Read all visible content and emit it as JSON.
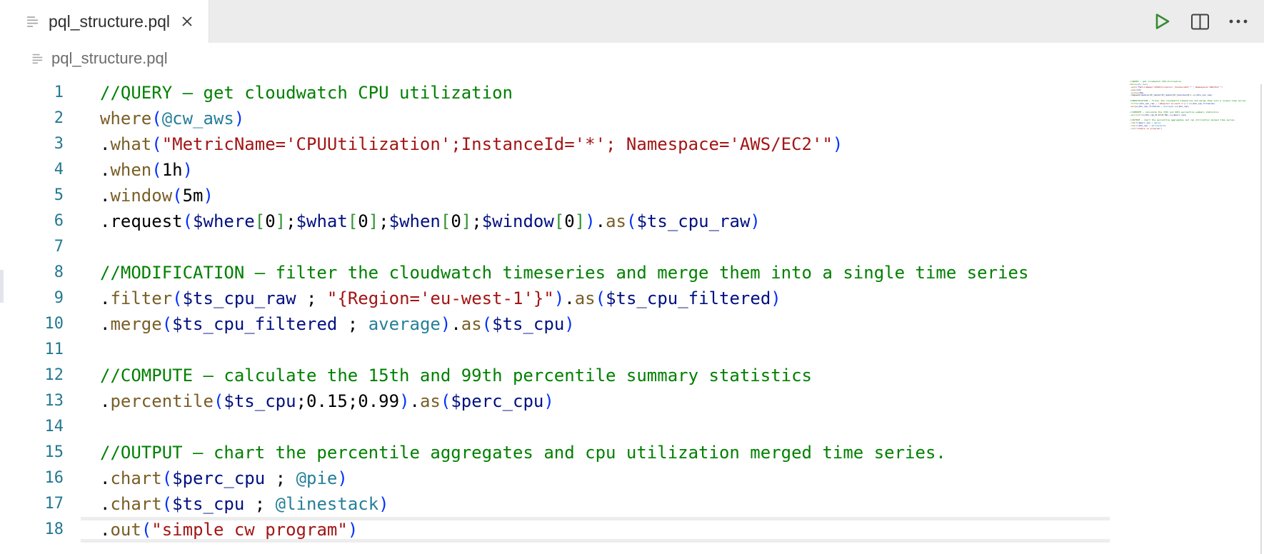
{
  "tab_bar": {
    "tabs": [
      {
        "label": "pql_structure.pql",
        "active": true,
        "close_icon": "x-icon"
      }
    ],
    "actions": [
      {
        "name": "run",
        "icon": "play-outline-icon"
      },
      {
        "name": "split-editor",
        "icon": "split-square-icon"
      },
      {
        "name": "more-actions",
        "icon": "ellipsis-icon"
      }
    ]
  },
  "breadcrumb": {
    "file": "pql_structure.pql",
    "icon": "file-lines-icon"
  },
  "editor": {
    "language": "pql",
    "current_line": 18,
    "lines": [
      {
        "n": 1,
        "t": [
          [
            "cm",
            "//QUERY – get cloudwatch CPU utilization"
          ]
        ]
      },
      {
        "n": 2,
        "t": [
          [
            "fn",
            "where"
          ],
          [
            "pa",
            "("
          ],
          [
            "at",
            "@cw_aws"
          ],
          [
            "pa",
            ")"
          ]
        ]
      },
      {
        "n": 3,
        "t": [
          [
            "pl",
            "."
          ],
          [
            "fn",
            "what"
          ],
          [
            "pa",
            "("
          ],
          [
            "st",
            "\"MetricName='CPUUtilization';InstanceId='*'; Namespace='AWS/EC2'\""
          ],
          [
            "pa",
            ")"
          ]
        ]
      },
      {
        "n": 4,
        "t": [
          [
            "pl",
            "."
          ],
          [
            "fn",
            "when"
          ],
          [
            "pa",
            "("
          ],
          [
            "nu",
            "1h"
          ],
          [
            "pa",
            ")"
          ]
        ]
      },
      {
        "n": 5,
        "t": [
          [
            "pl",
            "."
          ],
          [
            "fn",
            "window"
          ],
          [
            "pa",
            "("
          ],
          [
            "nu",
            "5m"
          ],
          [
            "pa",
            ")"
          ]
        ]
      },
      {
        "n": 6,
        "t": [
          [
            "pl",
            ".request"
          ],
          [
            "pa",
            "("
          ],
          [
            "vr",
            "$where"
          ],
          [
            "br",
            "["
          ],
          [
            "nu",
            "0"
          ],
          [
            "br",
            "]"
          ],
          [
            "pl",
            ";"
          ],
          [
            "vr",
            "$what"
          ],
          [
            "br",
            "["
          ],
          [
            "nu",
            "0"
          ],
          [
            "br",
            "]"
          ],
          [
            "pl",
            ";"
          ],
          [
            "vr",
            "$when"
          ],
          [
            "br",
            "["
          ],
          [
            "nu",
            "0"
          ],
          [
            "br",
            "]"
          ],
          [
            "pl",
            ";"
          ],
          [
            "vr",
            "$window"
          ],
          [
            "br",
            "["
          ],
          [
            "nu",
            "0"
          ],
          [
            "br",
            "]"
          ],
          [
            "pa",
            ")"
          ],
          [
            "pl",
            "."
          ],
          [
            "fn",
            "as"
          ],
          [
            "pa",
            "("
          ],
          [
            "vr",
            "$ts_cpu_raw"
          ],
          [
            "pa",
            ")"
          ]
        ]
      },
      {
        "n": 7,
        "t": []
      },
      {
        "n": 8,
        "t": [
          [
            "cm",
            "//MODIFICATION – filter the cloudwatch timeseries and merge them into a single time series"
          ]
        ]
      },
      {
        "n": 9,
        "t": [
          [
            "pl",
            "."
          ],
          [
            "fn",
            "filter"
          ],
          [
            "pa",
            "("
          ],
          [
            "vr",
            "$ts_cpu_raw"
          ],
          [
            "pl",
            " ; "
          ],
          [
            "st",
            "\"{Region='eu-west-1'}\""
          ],
          [
            "pa",
            ")"
          ],
          [
            "pl",
            "."
          ],
          [
            "fn",
            "as"
          ],
          [
            "pa",
            "("
          ],
          [
            "vr",
            "$ts_cpu_filtered"
          ],
          [
            "pa",
            ")"
          ]
        ]
      },
      {
        "n": 10,
        "t": [
          [
            "pl",
            "."
          ],
          [
            "fn",
            "merge"
          ],
          [
            "pa",
            "("
          ],
          [
            "vr",
            "$ts_cpu_filtered"
          ],
          [
            "pl",
            " ; "
          ],
          [
            "at",
            "average"
          ],
          [
            "pa",
            ")"
          ],
          [
            "pl",
            "."
          ],
          [
            "fn",
            "as"
          ],
          [
            "pa",
            "("
          ],
          [
            "vr",
            "$ts_cpu"
          ],
          [
            "pa",
            ")"
          ]
        ]
      },
      {
        "n": 11,
        "t": []
      },
      {
        "n": 12,
        "t": [
          [
            "cm",
            "//COMPUTE – calculate the 15th and 99th percentile summary statistics"
          ]
        ]
      },
      {
        "n": 13,
        "t": [
          [
            "pl",
            "."
          ],
          [
            "fn",
            "percentile"
          ],
          [
            "pa",
            "("
          ],
          [
            "vr",
            "$ts_cpu"
          ],
          [
            "pl",
            ";"
          ],
          [
            "nu",
            "0.15"
          ],
          [
            "pl",
            ";"
          ],
          [
            "nu",
            "0.99"
          ],
          [
            "pa",
            ")"
          ],
          [
            "pl",
            "."
          ],
          [
            "fn",
            "as"
          ],
          [
            "pa",
            "("
          ],
          [
            "vr",
            "$perc_cpu"
          ],
          [
            "pa",
            ")"
          ]
        ]
      },
      {
        "n": 14,
        "t": []
      },
      {
        "n": 15,
        "t": [
          [
            "cm",
            "//OUTPUT – chart the percentile aggregates and cpu utilization merged time series."
          ]
        ]
      },
      {
        "n": 16,
        "t": [
          [
            "pl",
            "."
          ],
          [
            "fn",
            "chart"
          ],
          [
            "pa",
            "("
          ],
          [
            "vr",
            "$perc_cpu"
          ],
          [
            "pl",
            " ; "
          ],
          [
            "at",
            "@pie"
          ],
          [
            "pa",
            ")"
          ]
        ]
      },
      {
        "n": 17,
        "t": [
          [
            "pl",
            "."
          ],
          [
            "fn",
            "chart"
          ],
          [
            "pa",
            "("
          ],
          [
            "vr",
            "$ts_cpu"
          ],
          [
            "pl",
            " ; "
          ],
          [
            "at",
            "@linestack"
          ],
          [
            "pa",
            ")"
          ]
        ]
      },
      {
        "n": 18,
        "t": [
          [
            "pl",
            "."
          ],
          [
            "fn",
            "out"
          ],
          [
            "pa",
            "("
          ],
          [
            "st",
            "\"simple cw program\""
          ],
          [
            "pa",
            ")"
          ]
        ]
      }
    ]
  },
  "colors": {
    "comment": "#008000",
    "string": "#a31515",
    "function": "#795e26",
    "variable": "#001080",
    "type": "#267f99",
    "number": "#000000",
    "paren": "#0431fa",
    "bracket": "#319331",
    "plain": "#000000",
    "lineNumber": "#237893",
    "tabText": "#2f2f2f",
    "breadcrumbText": "#6d6d6d",
    "tabstripBg": "#ececec",
    "runGreen": "#388a34",
    "iconDark": "#424242",
    "iconGray": "#a6a6a6",
    "highlightBorder": "#ededed",
    "edgeLine": "#dcdcdc",
    "leftMarker": "#e2e5ed"
  }
}
